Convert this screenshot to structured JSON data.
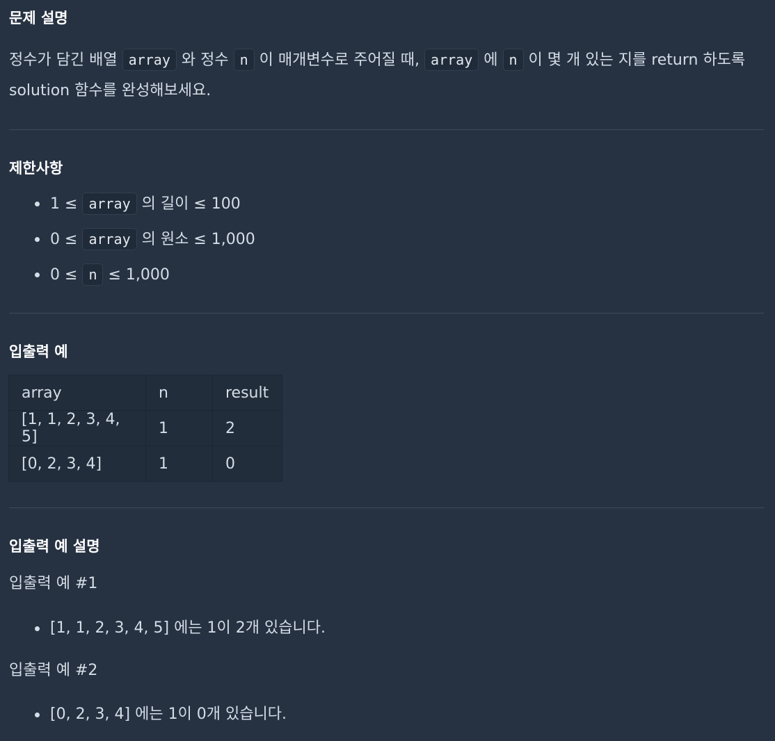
{
  "section_problem": {
    "title": "문제 설명",
    "t1": "정수가 담긴 배열",
    "c1": "array",
    "t2": "와 정수",
    "c2": "n",
    "t3": "이 매개변수로 주어질 때,",
    "c3": "array",
    "t4": "에",
    "c4": "n",
    "t5": "이 몇 개 있는 지를 return 하도록 solution 함수를 완성해보세요."
  },
  "section_constraints": {
    "title": "제한사항",
    "items": [
      {
        "pre": "1 ≤",
        "code": "array",
        "post": "의 길이 ≤ 100"
      },
      {
        "pre": "0 ≤",
        "code": "array",
        "post": "의 원소 ≤ 1,000"
      },
      {
        "pre": "0 ≤",
        "code": "n",
        "post": "≤ 1,000"
      }
    ]
  },
  "section_examples": {
    "title": "입출력 예",
    "headers": [
      "array",
      "n",
      "result"
    ],
    "rows": [
      [
        "[1, 1, 2, 3, 4, 5]",
        "1",
        "2"
      ],
      [
        "[0, 2, 3, 4]",
        "1",
        "0"
      ]
    ]
  },
  "section_explanation": {
    "title": "입출력 예 설명",
    "ex1_title": "입출력 예 #1",
    "ex1_item": "[1, 1, 2, 3, 4, 5] 에는 1이 2개 있습니다.",
    "ex2_title": "입출력 예 #2",
    "ex2_item": "[0, 2, 3, 4] 에는 1이 0개 있습니다."
  }
}
